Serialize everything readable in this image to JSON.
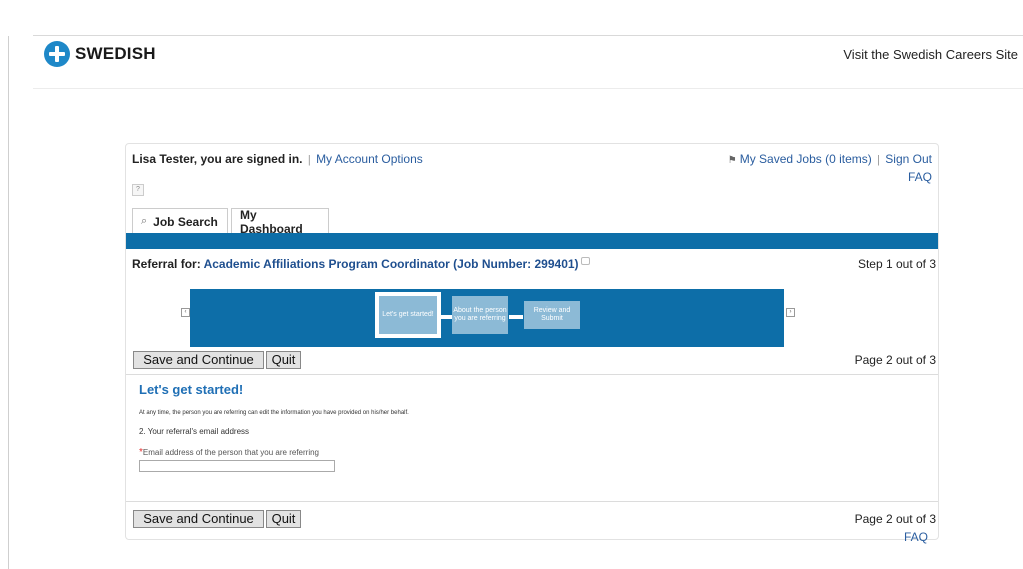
{
  "header": {
    "logo_text": "SWEDISH",
    "careers_link": "Visit the Swedish Careers Site"
  },
  "account": {
    "signed_in": "Lisa Tester, you are signed in.",
    "account_options": "My Account Options",
    "saved_jobs": "My Saved Jobs (0 items)",
    "sign_out": "Sign Out",
    "faq": "FAQ",
    "help": "?"
  },
  "tabs": [
    {
      "label": "Job Search",
      "icon": "search-icon"
    },
    {
      "label": "My Dashboard"
    }
  ],
  "referral": {
    "prefix": "Referral for:",
    "job_title": "Academic Affiliations Program Coordinator (Job Number: 299401)",
    "step": "Step 1 out of 3"
  },
  "progress": {
    "steps": [
      "Let's get started!",
      "About the person you are referring",
      "Review and Submit"
    ],
    "current_step": 1,
    "colors": {
      "bar": "#0d6ea8",
      "step": "#8cbad6"
    }
  },
  "form": {
    "save_label": "Save and Continue",
    "quit_label": "Quit",
    "page_info": "Page 2 out of 3",
    "section_title": "Let's get started!",
    "notice": "At any time, the person you are referring can edit the information you have provided on his/her behalf.",
    "question": "2. Your referral's email address",
    "required_mark": "*",
    "email_label": "Email address of the person that you are referring",
    "email_value": ""
  },
  "footer": {
    "faq": "FAQ"
  }
}
